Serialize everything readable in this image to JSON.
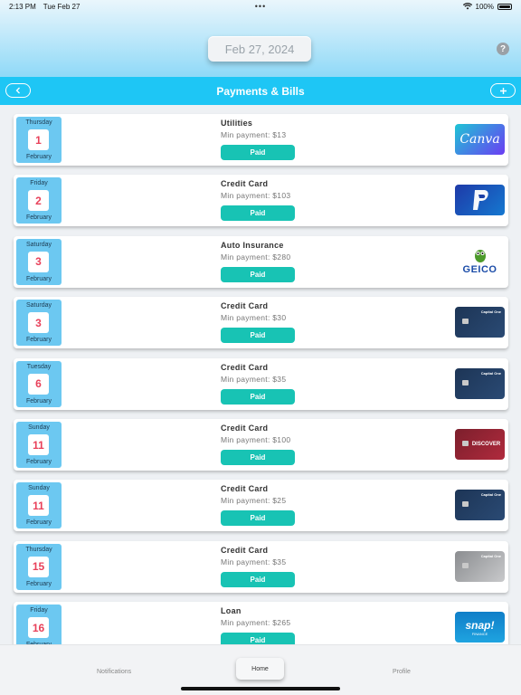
{
  "status": {
    "time": "2:13 PM",
    "date": "Tue Feb 27",
    "dots": "•••",
    "battery": "100%"
  },
  "header": {
    "selected_date": "Feb 27, 2024",
    "help_label": "?"
  },
  "nav": {
    "title": "Payments & Bills"
  },
  "bills": [
    {
      "dow": "Thursday",
      "day": "1",
      "month": "February",
      "name": "Utilities",
      "min": "Min payment: $13",
      "status": "Paid",
      "logo": "canva",
      "logo_text": "Canva"
    },
    {
      "dow": "Friday",
      "day": "2",
      "month": "February",
      "name": "Credit Card",
      "min": "Min payment: $103",
      "status": "Paid",
      "logo": "paypal"
    },
    {
      "dow": "Saturday",
      "day": "3",
      "month": "February",
      "name": "Auto Insurance",
      "min": "Min payment: $280",
      "status": "Paid",
      "logo": "geico",
      "logo_text": "GEICO"
    },
    {
      "dow": "Saturday",
      "day": "3",
      "month": "February",
      "name": "Credit Card",
      "min": "Min payment: $30",
      "status": "Paid",
      "logo": "capone",
      "logo_text": "Capital One"
    },
    {
      "dow": "Tuesday",
      "day": "6",
      "month": "February",
      "name": "Credit Card",
      "min": "Min payment: $35",
      "status": "Paid",
      "logo": "capone",
      "logo_text": "Capital One"
    },
    {
      "dow": "Sunday",
      "day": "11",
      "month": "February",
      "name": "Credit Card",
      "min": "Min payment: $100",
      "status": "Paid",
      "logo": "discover",
      "logo_text": "DISCOVER"
    },
    {
      "dow": "Sunday",
      "day": "11",
      "month": "February",
      "name": "Credit Card",
      "min": "Min payment: $25",
      "status": "Paid",
      "logo": "capone",
      "logo_text": "Capital One"
    },
    {
      "dow": "Thursday",
      "day": "15",
      "month": "February",
      "name": "Credit Card",
      "min": "Min payment: $35",
      "status": "Paid",
      "logo": "silver",
      "logo_text": "Capital One"
    },
    {
      "dow": "Friday",
      "day": "16",
      "month": "February",
      "name": "Loan",
      "min": "Min payment: $265",
      "status": "Paid",
      "logo": "snap",
      "logo_text": "snap!",
      "logo_sub": "FINANCE"
    }
  ],
  "tabs": {
    "notifications": "Notifications",
    "home": "Home",
    "profile": "Profile"
  },
  "colors": {
    "nav": "#1ec6f5",
    "paid": "#18c3b4",
    "date_box": "#6cc8f1",
    "day_number": "#e8415a"
  }
}
